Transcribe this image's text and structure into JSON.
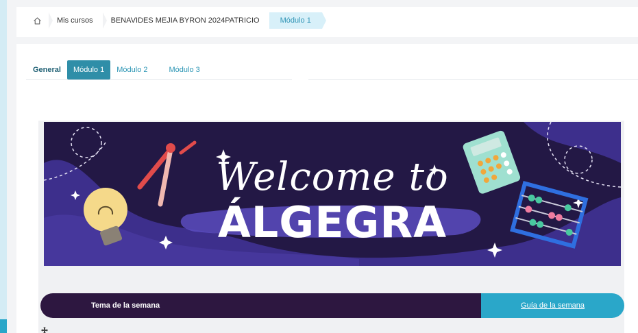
{
  "breadcrumb": {
    "items": [
      {
        "label": "Mis cursos"
      },
      {
        "label": "BENAVIDES MEJIA BYRON 2024PATRICIO"
      },
      {
        "label": "Módulo 1"
      }
    ]
  },
  "tabs": [
    {
      "label": "General"
    },
    {
      "label": "Módulo 1",
      "active": true
    },
    {
      "label": "Módulo 2"
    },
    {
      "label": "Módulo 3"
    }
  ],
  "banner": {
    "line1": "Welcome to",
    "line2": "ÁLGEGRA"
  },
  "week_bar": {
    "left_label": "Tema de la semana",
    "link_label": "Guía de la semana"
  },
  "icons": [
    "home-icon",
    "move-icon"
  ],
  "colors": {
    "accent": "#2f8ea8",
    "link": "#2b95b4",
    "banner_bg": "#231845",
    "week_left": "#2d1740",
    "week_right": "#2aa7c9"
  }
}
